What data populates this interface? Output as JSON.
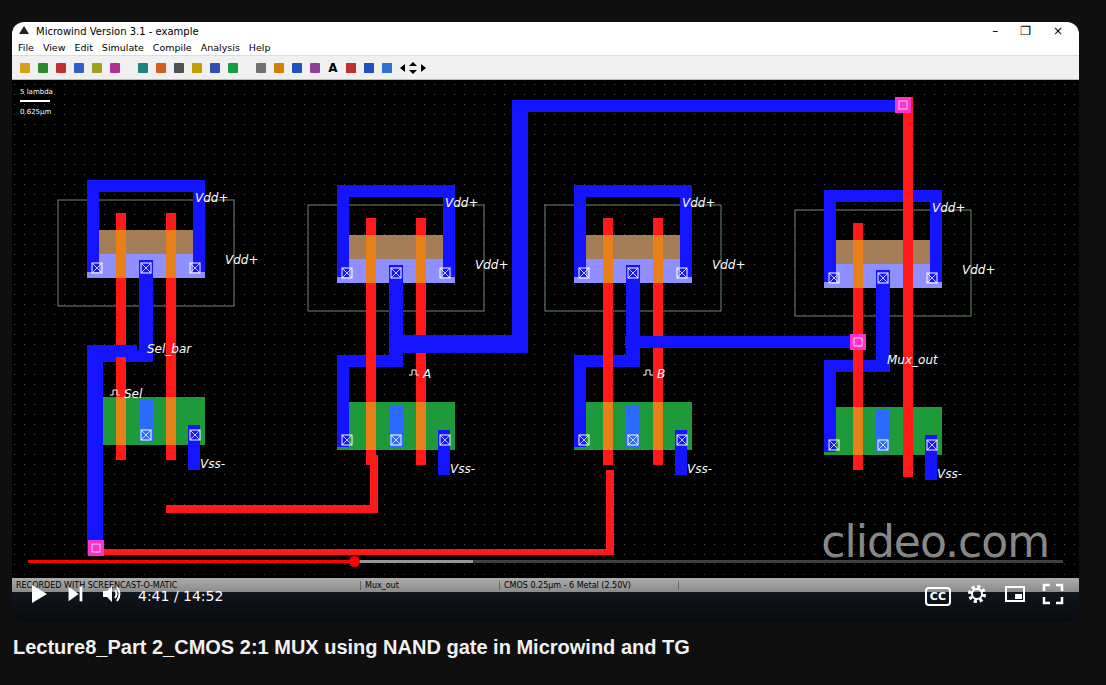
{
  "microwind": {
    "title": "Microwind Version 3.1 - example",
    "window_controls": [
      "–",
      "❐",
      "×"
    ],
    "menu": [
      "File",
      "View",
      "Edit",
      "Simulate",
      "Compile",
      "Analysis",
      "Help"
    ],
    "toolbar_glyphs": [
      "A"
    ],
    "scale": {
      "label": "5 lambda",
      "unit": "0.625µm"
    },
    "cells": [
      {
        "vdd": [
          "Vdd+",
          "Vdd+"
        ],
        "vss": "Vss-"
      },
      {
        "vdd": [
          "Vdd+",
          "Vdd+"
        ],
        "vss": "Vss-"
      },
      {
        "vdd": [
          "Vdd+",
          "Vdd+"
        ],
        "vss": "Vss-"
      },
      {
        "vdd": [
          "Vdd+",
          "Vdd+"
        ],
        "vss": "Vss-"
      }
    ],
    "signals": [
      {
        "label": "Sel_bar"
      },
      {
        "label": "Sel"
      },
      {
        "label": "A"
      },
      {
        "label": "B"
      },
      {
        "label": "Mux_out"
      }
    ],
    "status": [
      "RECORDED WITH SCREENCAST-O-MATIC",
      "Mux_out",
      "CMOS 0.25µm - 6 Metal (2.50V)"
    ]
  },
  "watermark": "clideo.com",
  "player": {
    "playing": false,
    "time": "4:41 / 14:52",
    "progress": 0.315,
    "buffered": 0.43,
    "captions": "CC"
  },
  "video_title": "Lecture8_Part 2_CMOS 2:1 MUX using NAND gate in Microwind and TG"
}
